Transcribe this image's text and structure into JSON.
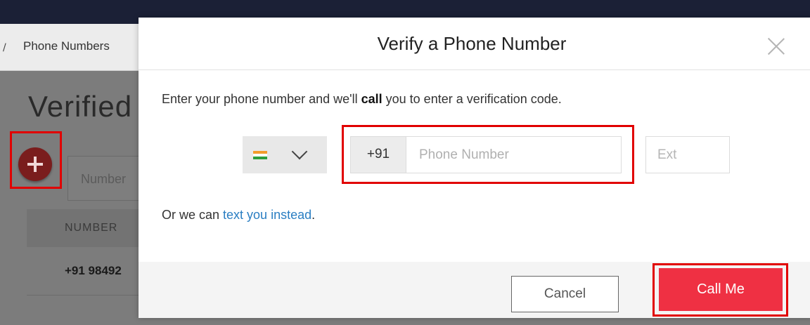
{
  "background_page": {
    "breadcrumb": "Phone Numbers",
    "title": "Verified",
    "search_placeholder": "Number",
    "table_header": "NUMBER",
    "row_number": "+91 98492"
  },
  "modal": {
    "title": "Verify a Phone Number",
    "instruction_before": "Enter your phone number and we'll ",
    "instruction_bold": "call",
    "instruction_after": " you to enter a verification code.",
    "country": {
      "flag": "india-flag",
      "dial_code": "+91"
    },
    "phone_placeholder": "Phone Number",
    "ext_placeholder": "Ext",
    "alt_prefix": "Or we can ",
    "alt_link": "text you instead",
    "alt_suffix": ".",
    "cancel_label": "Cancel",
    "call_label": "Call Me"
  },
  "colors": {
    "accent": "#ef3043",
    "link": "#2a7ec2",
    "highlight": "#e10000",
    "topbar": "#1b2036"
  }
}
